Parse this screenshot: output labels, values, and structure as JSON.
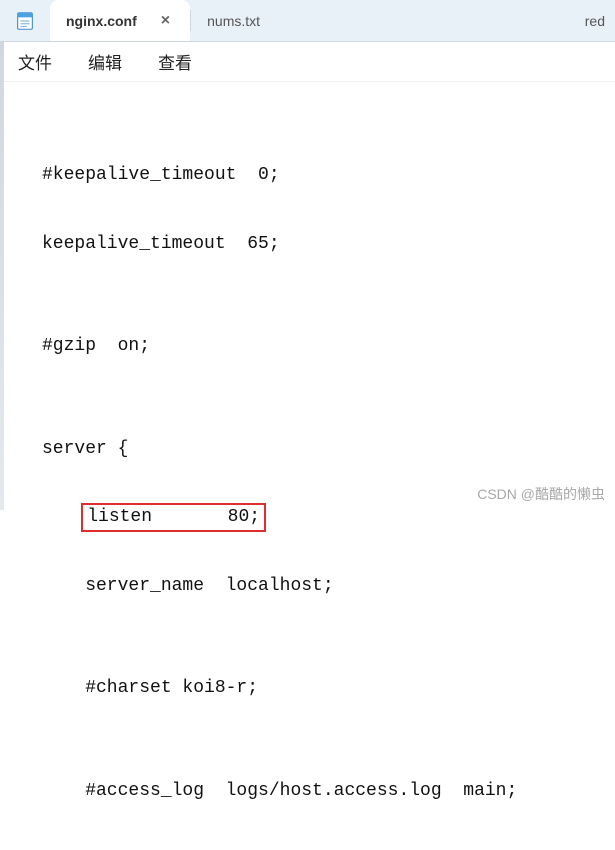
{
  "tabs": {
    "active": {
      "label": "nginx.conf"
    },
    "second": {
      "label": "nums.txt"
    },
    "overflow": {
      "label": "red"
    },
    "close_glyph": "×"
  },
  "menu": {
    "file": "文件",
    "edit": "编辑",
    "view": "查看"
  },
  "editor": {
    "lines": {
      "l1": "",
      "l2": "#keepalive_timeout  0;",
      "l3": "keepalive_timeout  65;",
      "l4": "",
      "l5": "#gzip  on;",
      "l6": "",
      "l7": "server {",
      "l8_indent": "    ",
      "l8_hl": "listen       80;",
      "l9": "    server_name  localhost;",
      "l10": "",
      "l11": "    #charset koi8-r;",
      "l12": "",
      "l13": "    #access_log  logs/host.access.log  main;"
    }
  },
  "watermark": "CSDN @酷酷的懒虫"
}
